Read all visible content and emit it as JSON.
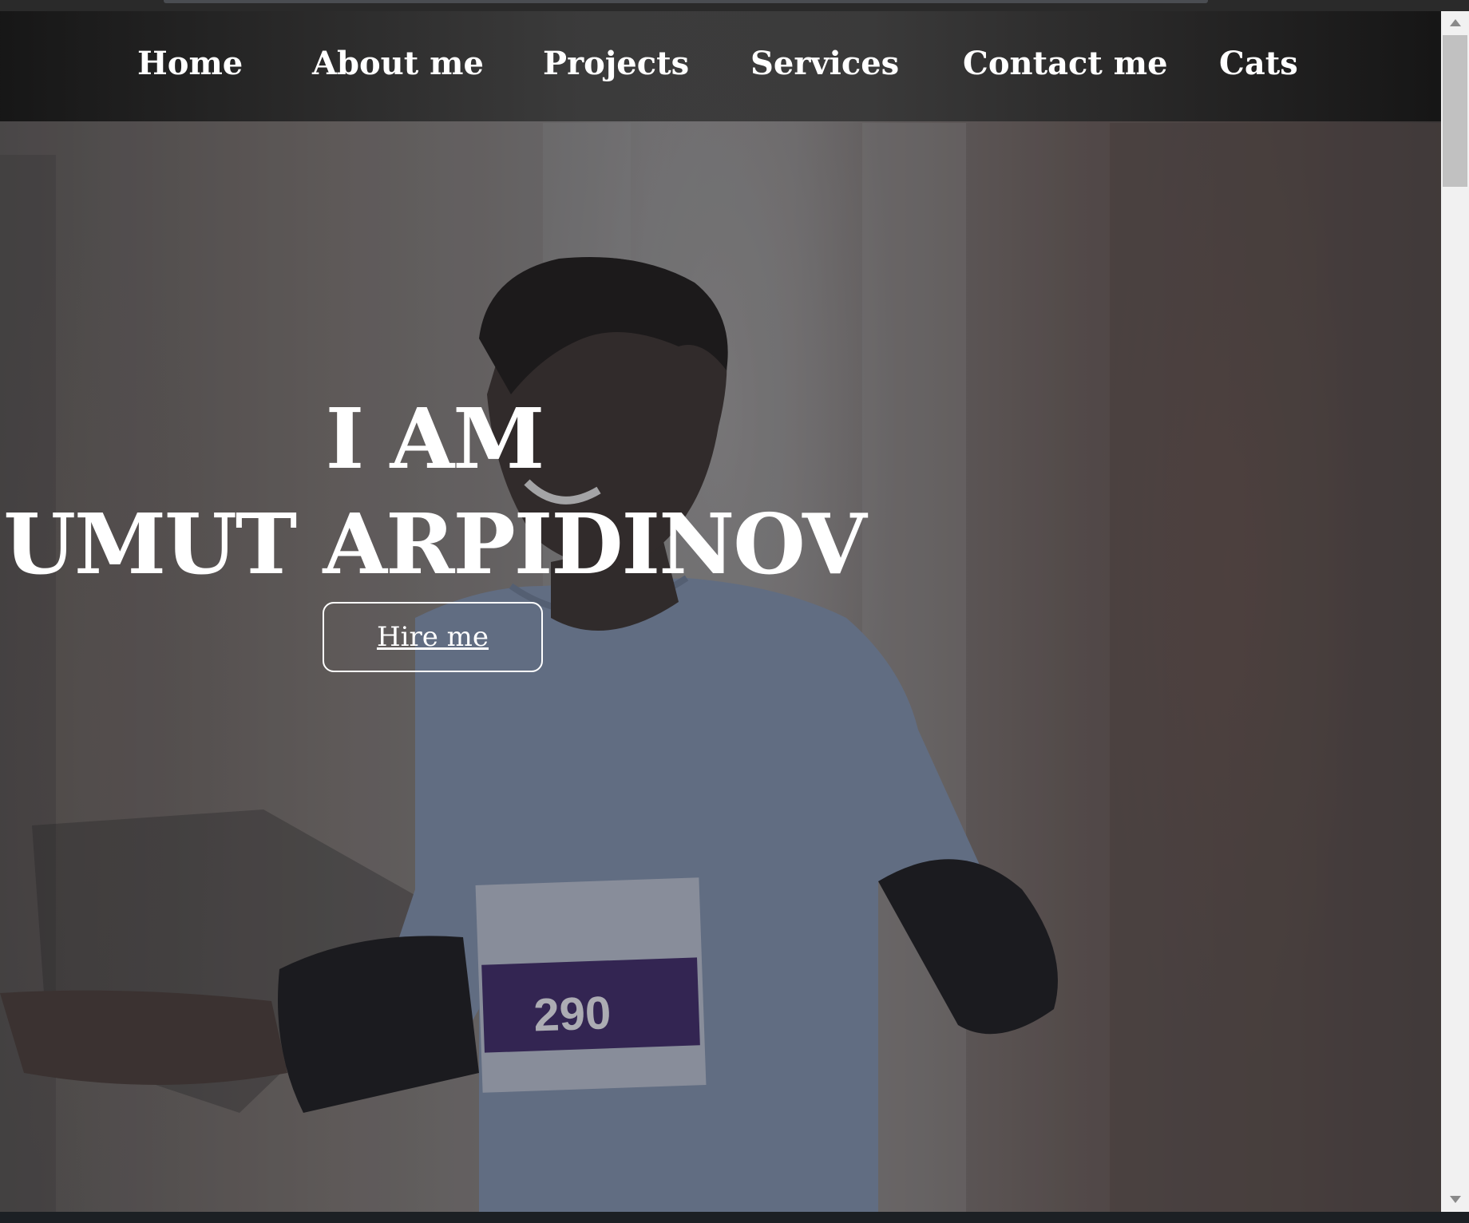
{
  "nav": {
    "items": [
      {
        "label": "Home"
      },
      {
        "label": "About me"
      },
      {
        "label": "Projects"
      },
      {
        "label": "Services"
      },
      {
        "label": "Contact me"
      },
      {
        "label": "Cats"
      }
    ]
  },
  "hero": {
    "line1": "I AM",
    "line2": "UMUT ARPIDINOV",
    "button_label": "Hire me",
    "background_image": "runner-photo",
    "bib_number": "290"
  },
  "colors": {
    "nav_text": "#ffffff",
    "hero_text": "#ffffff",
    "scrollbar_track": "#f1f1f1",
    "scrollbar_thumb": "#c1c1c1"
  }
}
